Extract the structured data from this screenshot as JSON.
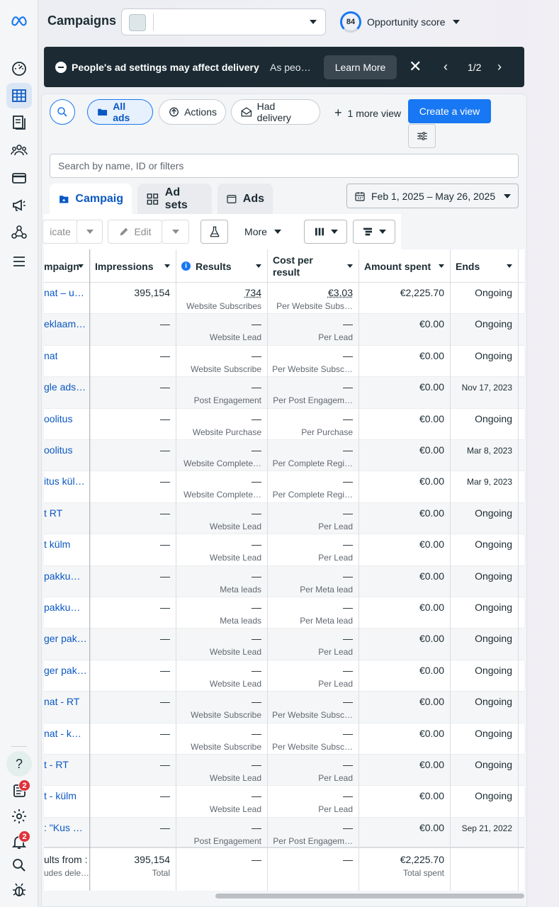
{
  "header": {
    "title": "Campaigns",
    "opportunity_score_value": "84",
    "opportunity_score_label": "Opportunity score"
  },
  "banner": {
    "title": "People's ad settings may affect delivery",
    "snippet": "As peo…",
    "learn_more": "Learn More",
    "page_indicator": "1/2"
  },
  "filters": {
    "all_ads": "All ads",
    "actions": "Actions",
    "had_delivery": "Had delivery",
    "more_views": "1 more view",
    "create_view": "Create a view",
    "search_placeholder": "Search by name, ID or filters"
  },
  "tabs": [
    {
      "label": "Campaig"
    },
    {
      "label": "Ad sets"
    },
    {
      "label": "Ads"
    }
  ],
  "date_range": "Feb 1, 2025 – May 26, 2025",
  "toolbar": {
    "duplicate": "icate",
    "edit": "Edit",
    "more": "More"
  },
  "columns": {
    "campaign": "mpaign",
    "impressions": "Impressions",
    "results": "Results",
    "cost_per_result_1": "Cost per",
    "cost_per_result_2": "result",
    "amount_spent": "Amount spent",
    "ends": "Ends"
  },
  "rows": [
    {
      "name": "nat – u…",
      "impressions": "395,154",
      "results": "734",
      "results_sub": "Website Subscribes",
      "cost": "€3.03",
      "cost_sub": "Per Website Subs…",
      "spent": "€2,225.70",
      "ends": "Ongoing"
    },
    {
      "name": "eklaami…",
      "impressions": "—",
      "results": "—",
      "results_sub": "Website Lead",
      "cost": "—",
      "cost_sub": "Per Lead",
      "spent": "€0.00",
      "ends": "Ongoing"
    },
    {
      "name": "nat",
      "impressions": "—",
      "results": "—",
      "results_sub": "Website Subscribe",
      "cost": "—",
      "cost_sub": "Per Website Subsc…",
      "spent": "€0.00",
      "ends": "Ongoing"
    },
    {
      "name": "gle ads…",
      "impressions": "—",
      "results": "—",
      "results_sub": "Post Engagement",
      "cost": "—",
      "cost_sub": "Per Post Engagem…",
      "spent": "€0.00",
      "ends": "Nov 17, 2023"
    },
    {
      "name": "oolitus",
      "impressions": "—",
      "results": "—",
      "results_sub": "Website Purchase",
      "cost": "—",
      "cost_sub": "Per Purchase",
      "spent": "€0.00",
      "ends": "Ongoing"
    },
    {
      "name": "oolitus",
      "impressions": "—",
      "results": "—",
      "results_sub": "Website Complete…",
      "cost": "—",
      "cost_sub": "Per Complete Regi…",
      "spent": "€0.00",
      "ends": "Mar 8, 2023"
    },
    {
      "name": "itus kül…",
      "impressions": "—",
      "results": "—",
      "results_sub": "Website Complete…",
      "cost": "—",
      "cost_sub": "Per Complete Regi…",
      "spent": "€0.00",
      "ends": "Mar 9, 2023"
    },
    {
      "name": "t RT",
      "impressions": "—",
      "results": "—",
      "results_sub": "Website Lead",
      "cost": "—",
      "cost_sub": "Per Lead",
      "spent": "€0.00",
      "ends": "Ongoing"
    },
    {
      "name": "t külm",
      "impressions": "—",
      "results": "—",
      "results_sub": "Website Lead",
      "cost": "—",
      "cost_sub": "Per Lead",
      "spent": "€0.00",
      "ends": "Ongoing"
    },
    {
      "name": "pakku…",
      "impressions": "—",
      "results": "—",
      "results_sub": "Meta leads",
      "cost": "—",
      "cost_sub": "Per Meta lead",
      "spent": "€0.00",
      "ends": "Ongoing"
    },
    {
      "name": " pakku…",
      "impressions": "—",
      "results": "—",
      "results_sub": "Meta leads",
      "cost": "—",
      "cost_sub": "Per Meta lead",
      "spent": "€0.00",
      "ends": "Ongoing"
    },
    {
      "name": "ger pak…",
      "impressions": "—",
      "results": "—",
      "results_sub": "Website Lead",
      "cost": "—",
      "cost_sub": "Per Lead",
      "spent": "€0.00",
      "ends": "Ongoing"
    },
    {
      "name": "ger pak…",
      "impressions": "—",
      "results": "—",
      "results_sub": "Website Lead",
      "cost": "—",
      "cost_sub": "Per Lead",
      "spent": "€0.00",
      "ends": "Ongoing"
    },
    {
      "name": "nat - RT",
      "impressions": "—",
      "results": "—",
      "results_sub": "Website Subscribe",
      "cost": "—",
      "cost_sub": "Per Website Subsc…",
      "spent": "€0.00",
      "ends": "Ongoing"
    },
    {
      "name": "nat - k…",
      "impressions": "—",
      "results": "—",
      "results_sub": "Website Subscribe",
      "cost": "—",
      "cost_sub": "Per Website Subsc…",
      "spent": "€0.00",
      "ends": "Ongoing"
    },
    {
      "name": "t - RT",
      "impressions": "—",
      "results": "—",
      "results_sub": "Website Lead",
      "cost": "—",
      "cost_sub": "Per Lead",
      "spent": "€0.00",
      "ends": "Ongoing"
    },
    {
      "name": "t - külm",
      "impressions": "—",
      "results": "—",
      "results_sub": "Website Lead",
      "cost": "—",
      "cost_sub": "Per Lead",
      "spent": "€0.00",
      "ends": "Ongoing"
    },
    {
      "name": ": \"Kus …",
      "impressions": "—",
      "results": "—",
      "results_sub": "Post Engagement",
      "cost": "—",
      "cost_sub": "Per Post Engagem…",
      "spent": "€0.00",
      "ends": "Sep 21, 2022"
    }
  ],
  "totals": {
    "name_1": "ults from :",
    "name_2": "udes dele…",
    "impressions": "395,154",
    "impressions_sub": "Total",
    "results": "—",
    "cost": "—",
    "spent": "€2,225.70",
    "spent_sub": "Total spent"
  },
  "rail": {
    "help": "?",
    "news_badge": "2",
    "notif_badge": "2"
  },
  "colors": {
    "accent": "#1877f2",
    "link": "#0a58c2",
    "banner_bg": "#1c2b33",
    "badge": "#e0323b"
  }
}
